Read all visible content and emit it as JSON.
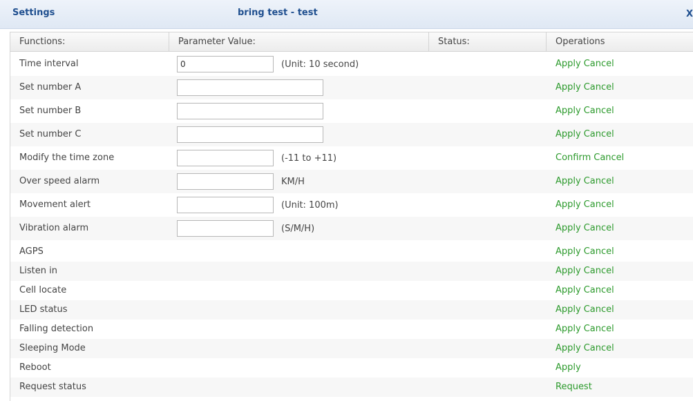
{
  "window": {
    "title": "Settings",
    "device_title": "bring test - test",
    "close_glyph": "X"
  },
  "columns": {
    "functions": "Functions:",
    "parameter_value": "Parameter Value:",
    "status": "Status:",
    "operations": "Operations"
  },
  "rows": [
    {
      "label": "Time interval",
      "input_value": "0",
      "unit": "(Unit: 10 second)",
      "ops": [
        "Apply",
        "Cancel"
      ]
    },
    {
      "label": "Set number A",
      "input_value": "",
      "unit": "",
      "ops": [
        "Apply",
        "Cancel"
      ]
    },
    {
      "label": "Set number B",
      "input_value": "",
      "unit": "",
      "ops": [
        "Apply",
        "Cancel"
      ]
    },
    {
      "label": "Set number C",
      "input_value": "",
      "unit": "",
      "ops": [
        "Apply",
        "Cancel"
      ]
    },
    {
      "label": "Modify the time zone",
      "input_value": "",
      "unit": "(-11 to +11)",
      "ops": [
        "Confirm",
        "Cancel"
      ]
    },
    {
      "label": "Over speed alarm",
      "input_value": "",
      "unit": "KM/H",
      "ops": [
        "Apply",
        "Cancel"
      ]
    },
    {
      "label": "Movement alert",
      "input_value": "",
      "unit": "(Unit: 100m)",
      "ops": [
        "Apply",
        "Cancel"
      ]
    },
    {
      "label": "Vibration alarm",
      "input_value": "",
      "unit": "(S/M/H)",
      "ops": [
        "Apply",
        "Cancel"
      ]
    },
    {
      "label": "AGPS",
      "ops": [
        "Apply",
        "Cancel"
      ]
    },
    {
      "label": "Listen in",
      "ops": [
        "Apply",
        "Cancel"
      ]
    },
    {
      "label": "Cell locate",
      "ops": [
        "Apply",
        "Cancel"
      ]
    },
    {
      "label": "LED status",
      "ops": [
        "Apply",
        "Cancel"
      ]
    },
    {
      "label": "Falling detection",
      "ops": [
        "Apply",
        "Cancel"
      ]
    },
    {
      "label": "Sleeping Mode",
      "ops": [
        "Apply",
        "Cancel"
      ]
    },
    {
      "label": "Reboot",
      "ops": [
        "Apply"
      ]
    },
    {
      "label": "Request status",
      "ops": [
        "Request"
      ]
    }
  ],
  "colors": {
    "title_text": "#1f4f8f",
    "op_link": "#2c9a2c"
  }
}
